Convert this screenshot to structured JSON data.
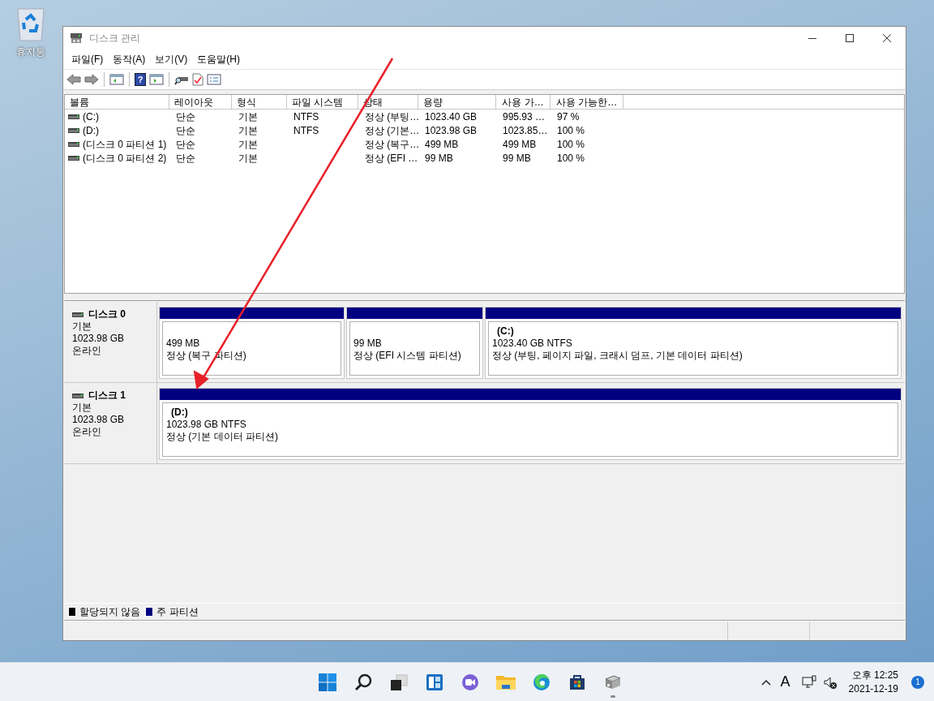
{
  "desktop": {
    "icons": [
      {
        "label": "휴지통"
      }
    ]
  },
  "window": {
    "title": "디스크 관리"
  },
  "menu": [
    "파일(F)",
    "동작(A)",
    "보기(V)",
    "도움말(H)"
  ],
  "toolbar": {
    "help_label": "?"
  },
  "volume_table": {
    "columns": [
      "볼륨",
      "레이아웃",
      "형식",
      "파일 시스템",
      "상태",
      "용량",
      "사용 가…",
      "사용 가능한…"
    ],
    "rows": [
      {
        "cells": [
          "(C:)",
          "단순",
          "기본",
          "NTFS",
          "정상 (부팅…",
          "1023.40 GB",
          "995.93 …",
          "97 %"
        ]
      },
      {
        "cells": [
          "(D:)",
          "단순",
          "기본",
          "NTFS",
          "정상 (기본…",
          "1023.98 GB",
          "1023.85…",
          "100 %"
        ]
      },
      {
        "cells": [
          "(디스크 0 파티션 1)",
          "단순",
          "기본",
          "",
          "정상 (복구…",
          "499 MB",
          "499 MB",
          "100 %"
        ]
      },
      {
        "cells": [
          "(디스크 0 파티션 2)",
          "단순",
          "기본",
          "",
          "정상 (EFI …",
          "99 MB",
          "99 MB",
          "100 %"
        ]
      }
    ]
  },
  "disks": [
    {
      "name": "디스크 0",
      "type": "기본",
      "size": "1023.98 GB",
      "status": "온라인",
      "partitions": [
        {
          "size": "499 MB",
          "status": "정상 (복구 파티션)"
        },
        {
          "size": "99 MB",
          "status": "정상 (EFI 시스템 파티션)"
        },
        {
          "label": "(C:)",
          "size": "1023.40 GB NTFS",
          "status": "정상 (부팅, 페이지 파일, 크래시 덤프, 기본 데이터 파티션)"
        }
      ]
    },
    {
      "name": "디스크 1",
      "type": "기본",
      "size": "1023.98 GB",
      "status": "온라인",
      "partitions": [
        {
          "label": "(D:)",
          "size": "1023.98 GB NTFS",
          "status": "정상 (기본 데이터 파티션)"
        }
      ]
    }
  ],
  "legend": [
    {
      "label": "할당되지 않음",
      "color": "#000000"
    },
    {
      "label": "주 파티션",
      "color": "#000080"
    }
  ],
  "taskbar": {
    "apps": [
      {
        "kind": "start",
        "running": false
      },
      {
        "kind": "search",
        "running": false
      },
      {
        "kind": "taskview",
        "running": false
      },
      {
        "kind": "widgets",
        "running": false
      },
      {
        "kind": "chat",
        "running": false
      },
      {
        "kind": "explorer",
        "running": false
      },
      {
        "kind": "edge",
        "running": false
      },
      {
        "kind": "store",
        "running": false
      },
      {
        "kind": "disk",
        "running": true
      }
    ],
    "ime": "A",
    "time": "오후 12:25",
    "date": "2021-12-19",
    "notifications": "1"
  }
}
